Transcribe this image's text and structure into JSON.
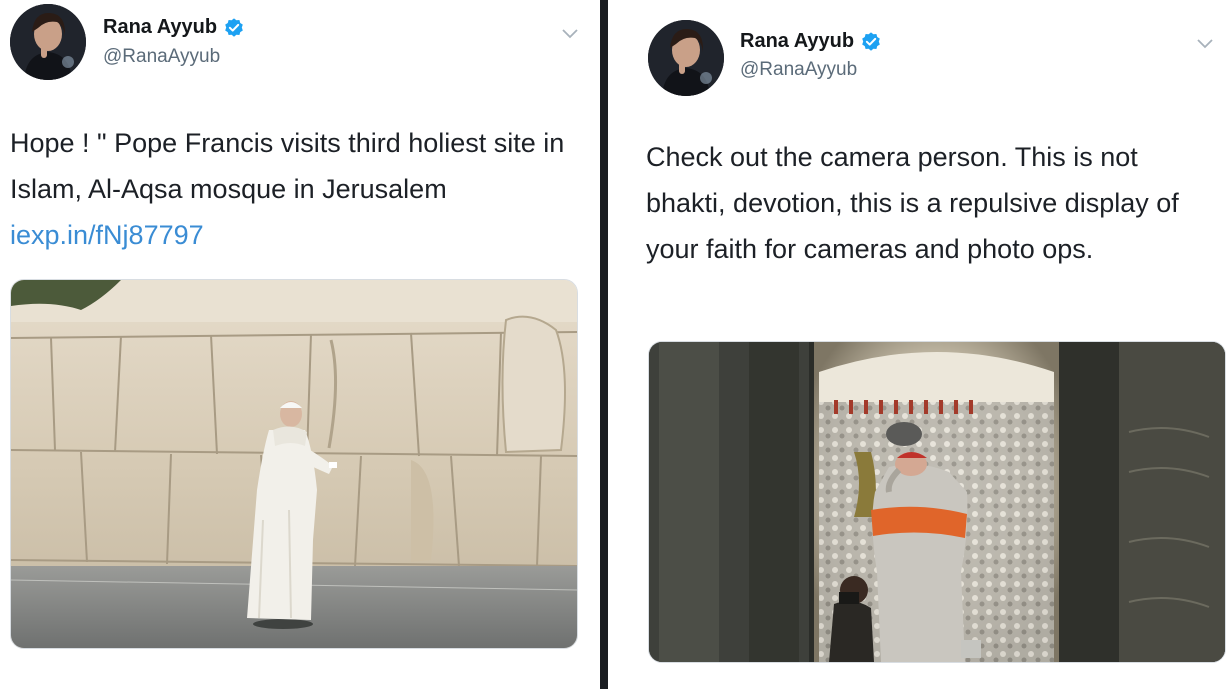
{
  "tweets": [
    {
      "display_name": "Rana Ayyub",
      "handle": "@RanaAyyub",
      "text": "Hope ! \" Pope Francis visits third holiest site in Islam, Al-Aqsa mosque in Jerusalem",
      "link": "iexp.in/fNj87797",
      "media_description": "Pope in white robes praying at a large stone wall",
      "verified_color": "#1da1f2"
    },
    {
      "display_name": "Rana Ayyub",
      "handle": "@RanaAyyub",
      "text": "Check out the camera person. This is not bhakti, devotion, this is a repulsive display of your faith for cameras and photo ops.",
      "media_description": "Person in robes bowing before an ornate silver shrine with a camera operator crouching nearby",
      "verified_color": "#1da1f2"
    }
  ]
}
